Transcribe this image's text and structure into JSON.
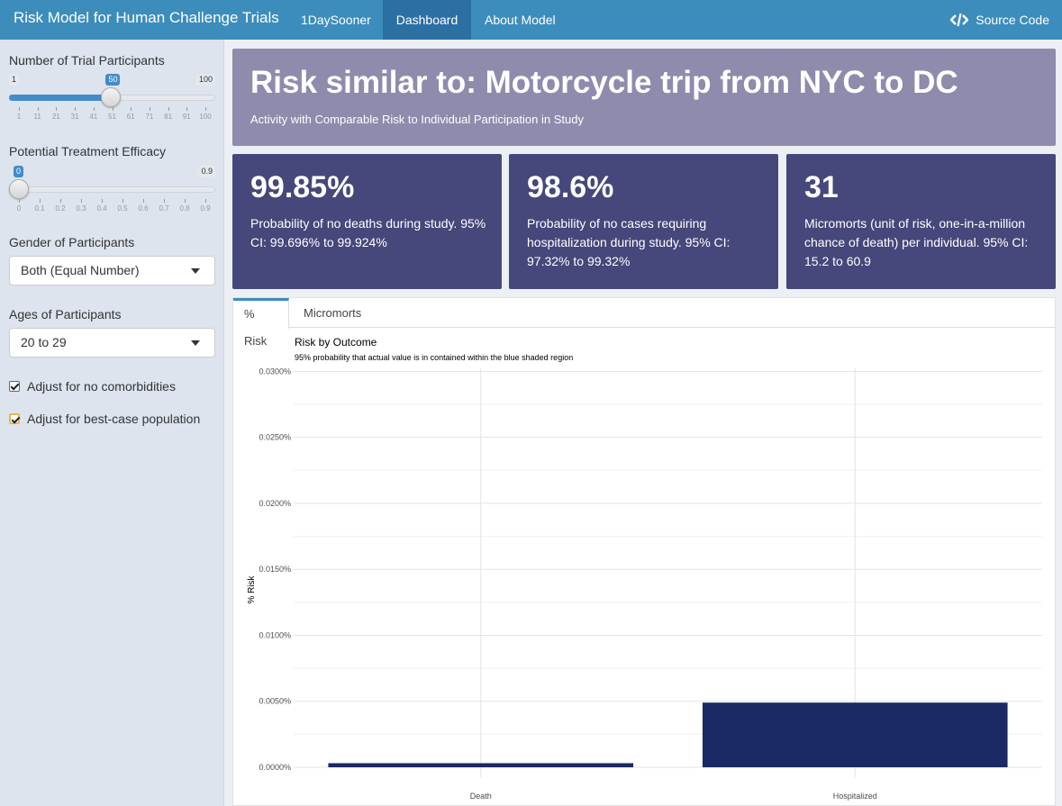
{
  "header": {
    "title": "Risk Model for Human Challenge Trials",
    "nav": [
      "1DaySooner",
      "Dashboard",
      "About Model"
    ],
    "source_label": "Source Code"
  },
  "sidebar": {
    "participants": {
      "label": "Number of Trial Participants",
      "min": "1",
      "max": "100",
      "value": "50",
      "value_fraction": 0.495,
      "ticks": [
        "1",
        "11",
        "21",
        "31",
        "41",
        "51",
        "61",
        "71",
        "81",
        "91",
        "100"
      ]
    },
    "efficacy": {
      "label": "Potential Treatment Efficacy",
      "min": "0",
      "max": "0.9",
      "value": "0",
      "value_fraction": 0,
      "ticks": [
        "0",
        "0.1",
        "0.2",
        "0.3",
        "0.4",
        "0.5",
        "0.6",
        "0.7",
        "0.8",
        "0.9"
      ]
    },
    "gender": {
      "label": "Gender of Participants",
      "value": "Both (Equal Number)"
    },
    "ages": {
      "label": "Ages of Participants",
      "value": "20 to 29"
    },
    "checkbox1": {
      "label": "Adjust for no comorbidities",
      "checked": true
    },
    "checkbox2": {
      "label": "Adjust for best-case population",
      "checked": true
    }
  },
  "banner": {
    "title": "Risk similar to: Motorcycle trip from NYC to DC",
    "subtitle": "Activity with Comparable Risk to Individual Participation in Study"
  },
  "boxes": [
    {
      "value": "99.85%",
      "text": "Probability of no deaths during study. 95% CI: 99.696% to 99.924%"
    },
    {
      "value": "98.6%",
      "text": "Probability of no cases requiring hospitalization during study. 95% CI: 97.32% to 99.32%"
    },
    {
      "value": "31",
      "text": "Micromorts (unit of risk, one-in-a-million chance of death) per individual. 95% CI: 15.2 to 60.9"
    }
  ],
  "tabs": [
    "% Risk",
    "Micromorts"
  ],
  "colors": {
    "header": "#3c8dbc",
    "bar": "#1c2a63",
    "banner": "#8e8bad",
    "box": "#46477a"
  },
  "chart_data": {
    "type": "bar",
    "title": "Risk by Outcome",
    "subtitle": "95% probability that actual value is in contained within the blue shaded region",
    "ylabel": "% Risk",
    "categories": [
      "Death",
      "Hospitalized"
    ],
    "values": [
      0.00031,
      0.0049
    ],
    "ylim": [
      0,
      0.0303
    ],
    "yticks": [
      0,
      0.005,
      0.01,
      0.015,
      0.02,
      0.025,
      0.03
    ],
    "ytick_labels": [
      "0.0000%",
      "0.0050%",
      "0.0100%",
      "0.0150%",
      "0.0200%",
      "0.0250%",
      "0.0300%"
    ],
    "grid": true
  }
}
